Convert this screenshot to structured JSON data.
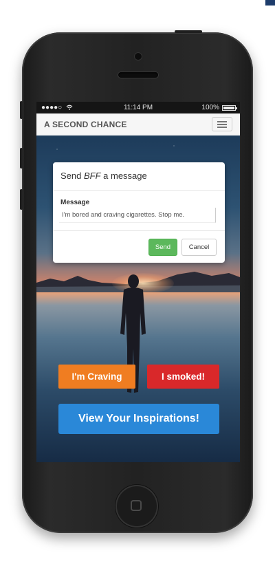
{
  "status_bar": {
    "signal": "●●●●○",
    "time": "11:14 PM",
    "battery_text": "100%"
  },
  "navbar": {
    "brand": "A SECOND CHANCE"
  },
  "modal": {
    "title_prefix": "Send ",
    "title_contact": "BFF",
    "title_suffix": " a message",
    "message_label": "Message",
    "message_value": "I'm bored and craving cigarettes. Stop me.",
    "send_label": "Send",
    "cancel_label": "Cancel"
  },
  "actions": {
    "craving_label": "I'm Craving",
    "smoked_label": "I smoked!",
    "inspirations_label": "View Your Inspirations!"
  },
  "colors": {
    "craving": "#f07d21",
    "smoked": "#d9282a",
    "inspirations": "#2a88d8",
    "send": "#5cb85c"
  }
}
